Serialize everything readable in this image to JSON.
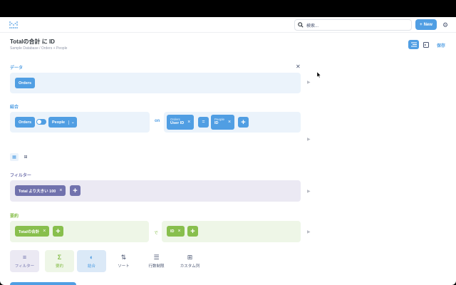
{
  "topbar": {
    "search_placeholder": "検索...",
    "new_label": "New"
  },
  "header": {
    "title": "Totalの合計 に ID",
    "breadcrumb": "Sample Database  /  Orders + People",
    "save_label": "保存"
  },
  "sections": {
    "data": {
      "label": "データ",
      "table": "Orders"
    },
    "join": {
      "label": "結合",
      "left_table": "Orders",
      "right_table": "People",
      "on_word": "on",
      "left_column_table": "Orders",
      "left_column": "User ID",
      "operator": "=",
      "right_column_table": "People",
      "right_column": "ID"
    },
    "filter": {
      "label": "フィルター",
      "condition": "Total より大きい 100"
    },
    "summarize": {
      "label": "要約",
      "metric": "Totalの合計",
      "by_word": "で",
      "breakout": "ID"
    }
  },
  "steps": [
    {
      "label": "フィルター",
      "icon": "filter-icon"
    },
    {
      "label": "要約",
      "icon": "sigma-icon"
    },
    {
      "label": "結合",
      "icon": "join-icon"
    },
    {
      "label": "ソート",
      "icon": "sort-icon"
    },
    {
      "label": "行数制限",
      "icon": "list-icon"
    },
    {
      "label": "カスタム列",
      "icon": "custom-column-icon"
    }
  ],
  "colors": {
    "brand": "#509ee3",
    "filter": "#7172ad",
    "summarize": "#88bf4d",
    "data_label": "#509ee3"
  }
}
